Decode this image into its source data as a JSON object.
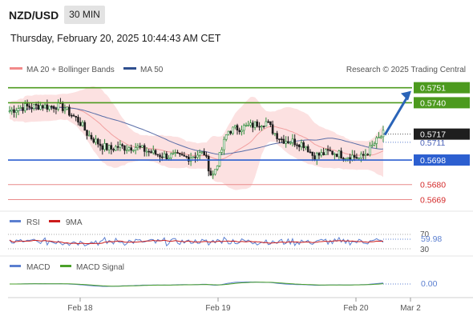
{
  "header": {
    "pair": "NZD/USD",
    "timeframe": "30 MIN",
    "datetime": "Thursday, February 20, 2025 10:44:43 AM CET"
  },
  "legend": {
    "bollinger": "MA 20 + Bollinger Bands",
    "ma50": "MA 50",
    "copyright": "Research © 2025 Trading Central",
    "rsi": "RSI",
    "rsi_ma": "9MA",
    "macd": "MACD",
    "macd_signal": "MACD Signal"
  },
  "colors": {
    "candle": "#2e8b3a",
    "bollinger_fill": "#fbdcdc",
    "ma20": "#f2a0a0",
    "ma50": "#5a6ea8",
    "resistance": "#4c9a1e",
    "pivot": "#2c5fd0",
    "support": "#e98a8a",
    "arrow": "#2a64b8",
    "rsi": "#5b7fd0",
    "rsi_ma": "#cc1b1b",
    "macd": "#5b7fd0",
    "macd_signal": "#4aa02a"
  },
  "x_axis": [
    "Feb 18",
    "Feb 19",
    "Feb 20",
    "Mar 2"
  ],
  "chart_data": [
    {
      "type": "candlestick",
      "title": "NZD/USD 30 MIN",
      "ylim": [
        0.5664,
        0.5759
      ],
      "current_price": 0.5717,
      "ma_value": 0.5711,
      "levels": [
        {
          "value": 0.5751,
          "kind": "resistance",
          "label": "0.5751"
        },
        {
          "value": 0.574,
          "kind": "resistance",
          "label": "0.5740"
        },
        {
          "value": 0.5698,
          "kind": "pivot",
          "label": "0.5698"
        },
        {
          "value": 0.568,
          "kind": "support",
          "label": "0.5680"
        },
        {
          "value": 0.5669,
          "kind": "support",
          "label": "0.5669"
        }
      ],
      "close_path": [
        0.5734,
        0.5736,
        0.5737,
        0.5737,
        0.5738,
        0.5737,
        0.5738,
        0.5736,
        0.5731,
        0.5726,
        0.5717,
        0.5712,
        0.5708,
        0.5706,
        0.5708,
        0.5707,
        0.5708,
        0.5706,
        0.5704,
        0.5702,
        0.5701,
        0.5701,
        0.57,
        0.57,
        0.5702,
        0.5703,
        0.5685,
        0.5701,
        0.5719,
        0.5721,
        0.5722,
        0.5723,
        0.5725,
        0.5726,
        0.5718,
        0.5713,
        0.5712,
        0.5711,
        0.5709,
        0.5701,
        0.5702,
        0.5704,
        0.5703,
        0.5701,
        0.5701,
        0.5699,
        0.5704,
        0.5711,
        0.5717
      ],
      "target": 0.5751
    },
    {
      "type": "line",
      "title": "RSI",
      "ticks": [
        "70",
        "30"
      ],
      "last_value": "59.98"
    },
    {
      "type": "line",
      "title": "MACD",
      "last_value": "0.00"
    }
  ]
}
